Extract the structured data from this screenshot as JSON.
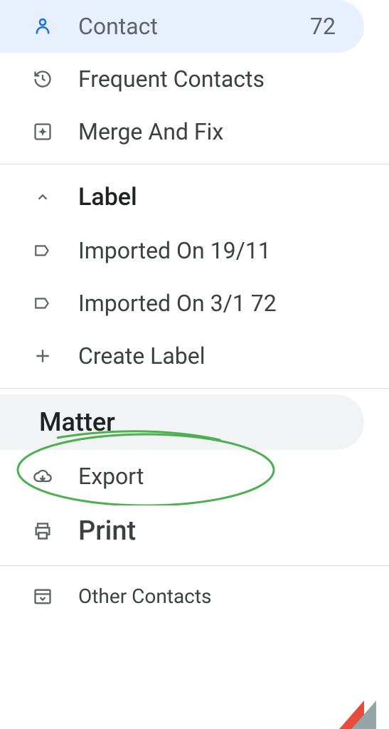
{
  "nav": {
    "contact": {
      "label": "Contact",
      "count": "72"
    },
    "frequent": {
      "label": "Frequent Contacts"
    },
    "merge": {
      "label": "Merge And Fix"
    }
  },
  "labels": {
    "header": "Label",
    "items": [
      {
        "label": "Imported On 19/11"
      },
      {
        "label": "Imported On 3/1 72"
      }
    ],
    "create": "Create Label"
  },
  "actions": {
    "import": "Matter",
    "export": "Export",
    "print": "Print"
  },
  "other": {
    "label": "Other Contacts"
  }
}
